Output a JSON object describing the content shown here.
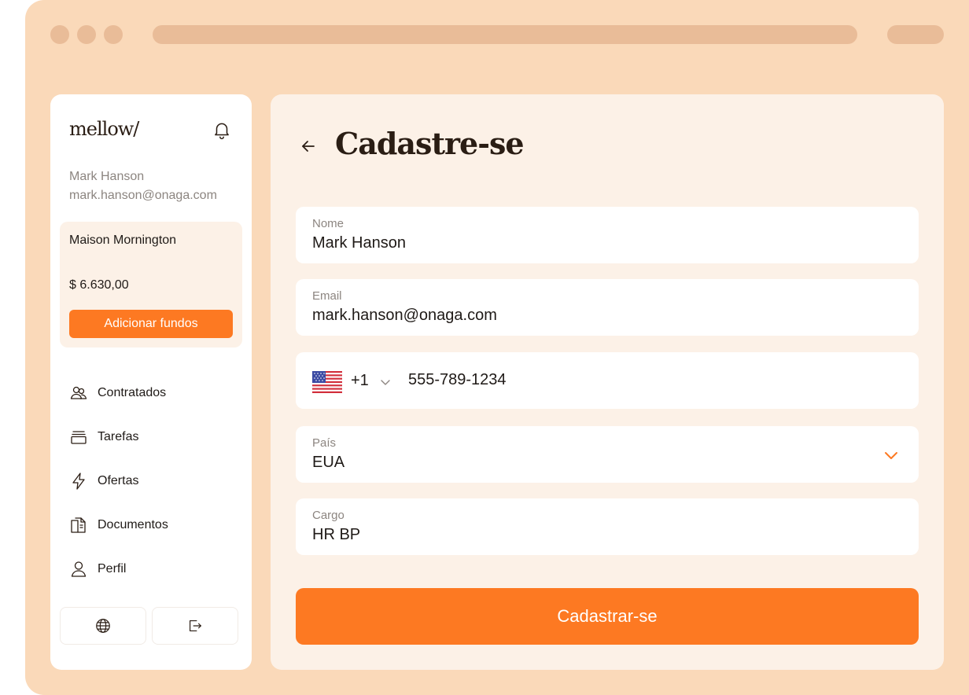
{
  "brand": {
    "logo": "mellow/"
  },
  "user": {
    "name": "Mark Hanson",
    "email": "mark.hanson@onaga.com"
  },
  "account_card": {
    "title": "Maison Mornington",
    "amount": "$ 6.630,00",
    "add_funds_label": "Adicionar fundos"
  },
  "nav": {
    "items": [
      {
        "label": "Contratados",
        "icon": "users-icon"
      },
      {
        "label": "Tarefas",
        "icon": "stack-icon"
      },
      {
        "label": "Ofertas",
        "icon": "lightning-icon"
      },
      {
        "label": "Documentos",
        "icon": "documents-icon"
      },
      {
        "label": "Perfil",
        "icon": "user-icon"
      }
    ]
  },
  "footer_icons": [
    "globe-icon",
    "logout-icon"
  ],
  "page": {
    "title": "Cadastre-se"
  },
  "form": {
    "name": {
      "label": "Nome",
      "value": "Mark Hanson"
    },
    "email": {
      "label": "Email",
      "value": "mark.hanson@onaga.com"
    },
    "phone": {
      "dial_code": "+1",
      "value": "555-789-1234",
      "flag": "us-flag-icon"
    },
    "country": {
      "label": "País",
      "value": "EUA"
    },
    "role": {
      "label": "Cargo",
      "value": "HR BP"
    },
    "submit_label": "Cadastrar-se"
  },
  "colors": {
    "accent": "#fd7922",
    "frame": "#fad9b9",
    "panel": "#fcf1e7",
    "frame_bar": "#e9bc98"
  }
}
